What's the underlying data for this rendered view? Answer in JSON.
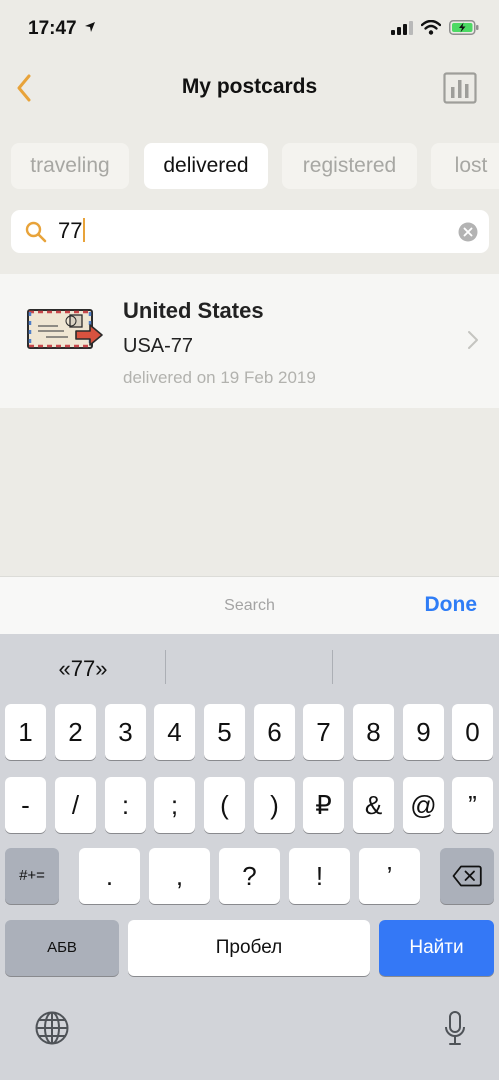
{
  "status": {
    "time": "17:47"
  },
  "nav": {
    "title": "My postcards",
    "back_icon": "chevron-left-icon",
    "stats_icon": "bar-chart-icon"
  },
  "tabs": [
    {
      "label": "traveling",
      "active": false
    },
    {
      "label": "delivered",
      "active": true
    },
    {
      "label": "registered",
      "active": false
    },
    {
      "label": "lost",
      "active": false
    }
  ],
  "search": {
    "value": "77"
  },
  "results": [
    {
      "country": "United States",
      "code": "USA-77",
      "status": "delivered on 19 Feb 2019"
    }
  ],
  "accessory": {
    "label": "Search",
    "done_label": "Done"
  },
  "keyboard": {
    "suggestions": [
      "«77»",
      "",
      ""
    ],
    "row1": [
      "1",
      "2",
      "3",
      "4",
      "5",
      "6",
      "7",
      "8",
      "9",
      "0"
    ],
    "row2": [
      "-",
      "/",
      ":",
      ";",
      "(",
      ")",
      "₽",
      "&",
      "@",
      "”"
    ],
    "row3_mode": "#+=",
    "row3": [
      ".",
      ",",
      "?",
      "!",
      "’"
    ],
    "abc_label": "АБВ",
    "space_label": "Пробел",
    "go_label": "Найти"
  },
  "colors": {
    "accent": "#e8a33a",
    "done": "#2f7df6",
    "go": "#3478f6",
    "background": "#ecebe6"
  }
}
